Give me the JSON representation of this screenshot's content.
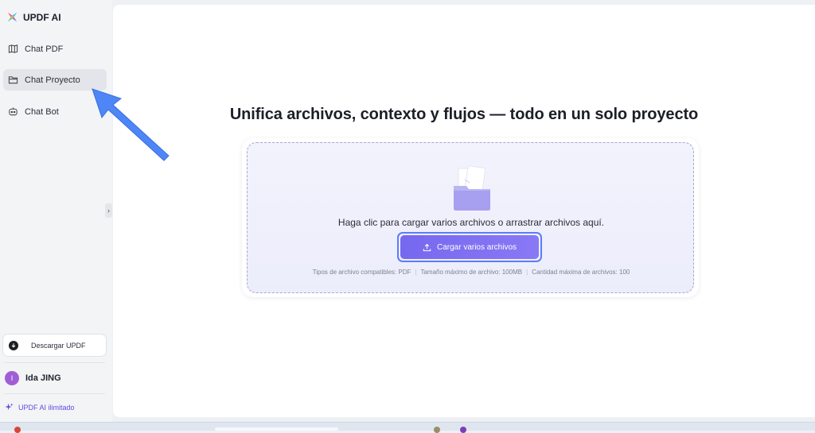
{
  "app": {
    "title": "UPDF AI"
  },
  "sidebar": {
    "items": [
      {
        "label": "Chat PDF",
        "icon": "book-icon",
        "active": false
      },
      {
        "label": "Chat Proyecto",
        "icon": "folder-icon",
        "active": true
      },
      {
        "label": "Chat Bot",
        "icon": "bot-icon",
        "active": false
      }
    ],
    "download_label": "Descargar UPDF",
    "user": {
      "initial": "I",
      "name": "Ida JING"
    },
    "plan_label": "UPDF AI ilimitado"
  },
  "main": {
    "headline": "Unifica archivos, contexto y flujos — todo en un solo proyecto",
    "dropzone": {
      "instruction": "Haga clic para cargar varios archivos o arrastrar archivos aquí.",
      "button_label": "Cargar varios archivos",
      "limits": [
        "Tipos de archivo compatibles: PDF",
        "Tamaño máximo de archivo: 100MB",
        "Cantidad máxima de archivos: 100"
      ]
    }
  },
  "colors": {
    "accent": "#7668ef",
    "pointer_arrow": "#4f86f7",
    "avatar": "#a05ed6"
  }
}
